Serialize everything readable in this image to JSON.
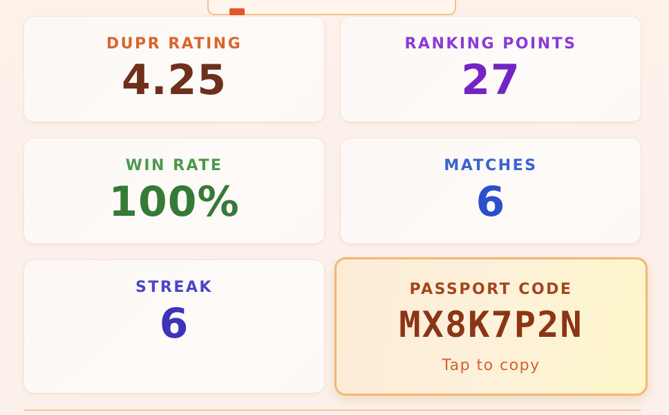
{
  "colors": {
    "dupr_label": "#d9662e",
    "dupr_value": "#6e2f1b",
    "rank_label": "#8b3bd6",
    "rank_value": "#7424c4",
    "win_label": "#4a9a4c",
    "win_value": "#367a38",
    "matches_label": "#3a62d4",
    "matches_value": "#2b4fcc",
    "streak_label": "#4b45c6",
    "streak_value": "#3d33b8",
    "passport_label": "#a34520",
    "passport_code": "#8c3516",
    "passport_hint": "#d0622e",
    "passport_border": "#f0b776"
  },
  "stats": {
    "dupr": {
      "label": "DUPR RATING",
      "value": "4.25"
    },
    "ranking": {
      "label": "RANKING POINTS",
      "value": "27"
    },
    "win_rate": {
      "label": "WIN RATE",
      "value": "100%"
    },
    "matches": {
      "label": "MATCHES",
      "value": "6"
    },
    "streak": {
      "label": "STREAK",
      "value": "6"
    }
  },
  "passport": {
    "label": "PASSPORT CODE",
    "code": "MX8K7P2N",
    "hint": "Tap to copy"
  }
}
